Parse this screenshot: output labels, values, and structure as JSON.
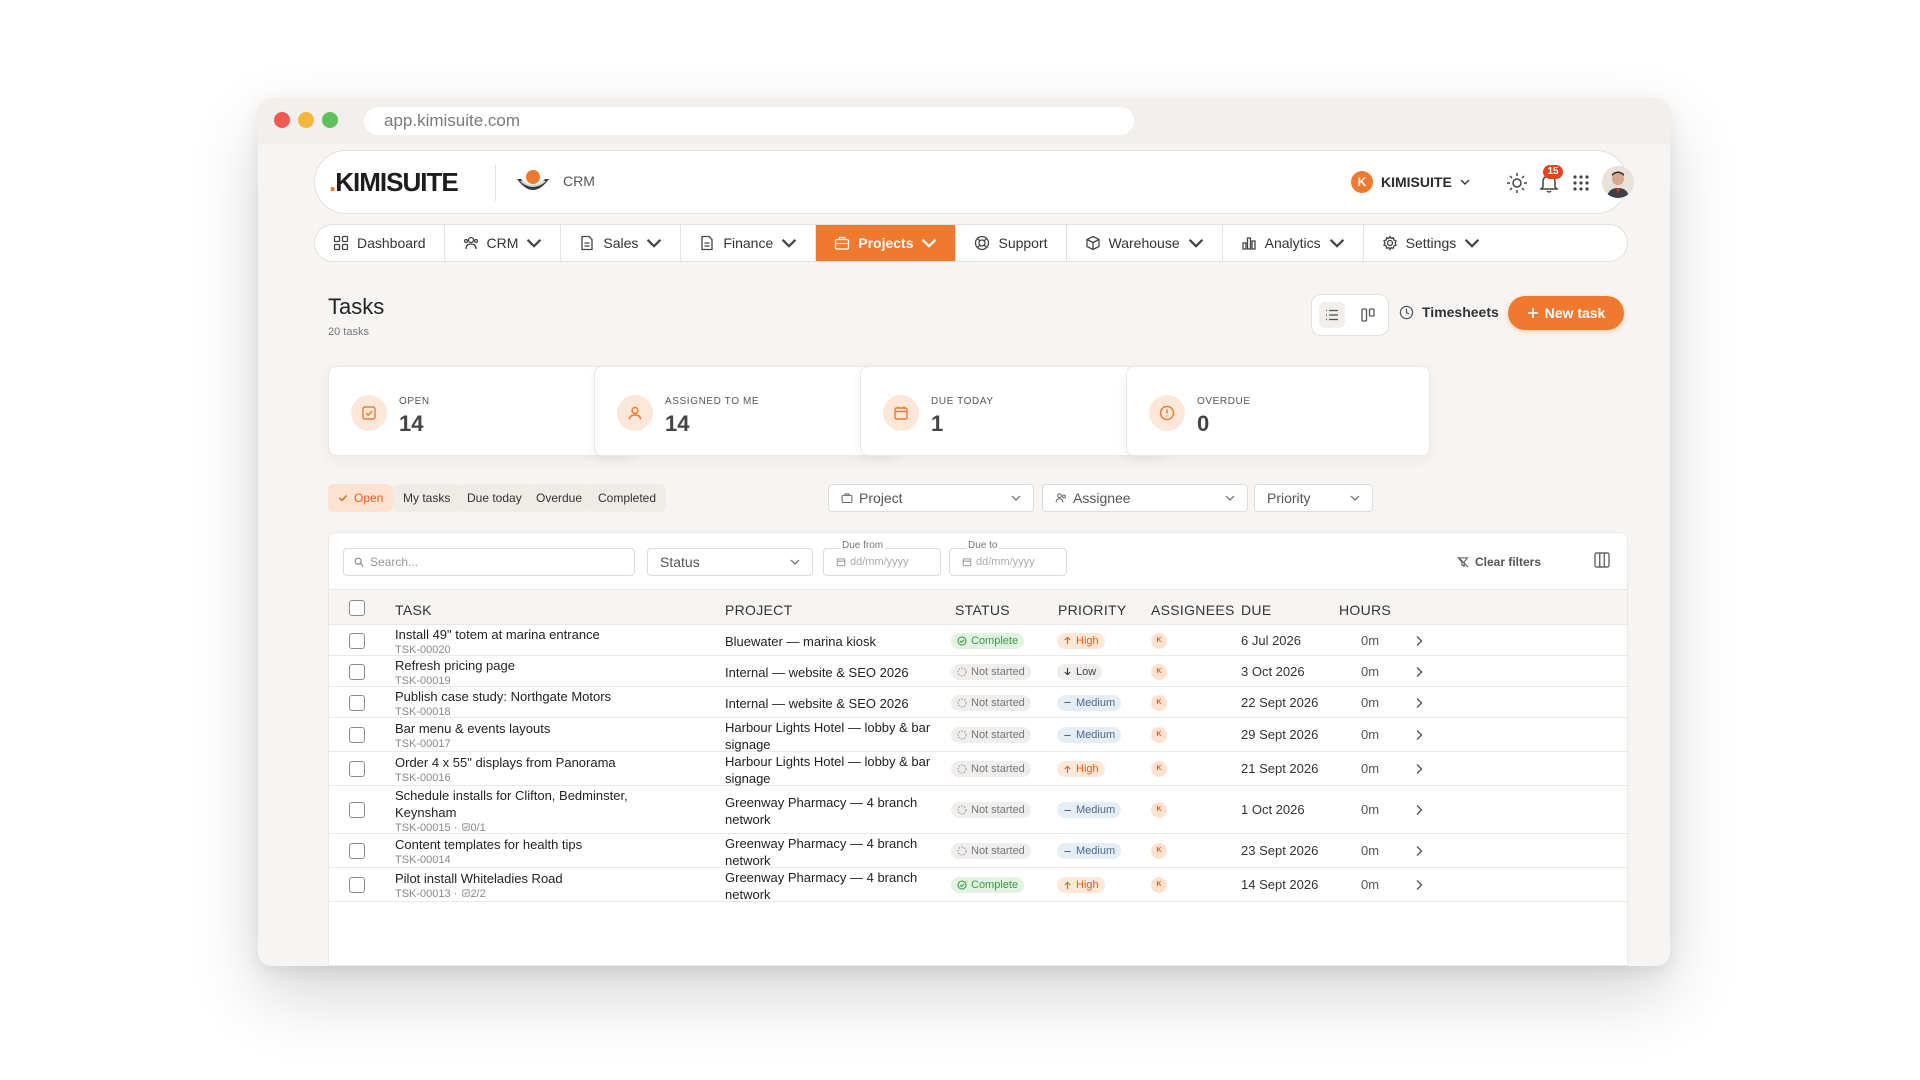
{
  "browser": {
    "url": "app.kimisuite.com"
  },
  "header": {
    "logo_dot": ".",
    "logo_text": "KIMISUITE",
    "module_label": "CRM",
    "org_initial": "K",
    "org_name": "KIMISUITE",
    "notifications_count": "15"
  },
  "nav": {
    "items": [
      {
        "label": "Dashboard",
        "icon": "grid-icon"
      },
      {
        "label": "CRM",
        "icon": "users-icon"
      },
      {
        "label": "Sales",
        "icon": "document-icon"
      },
      {
        "label": "Finance",
        "icon": "document-icon"
      },
      {
        "label": "Projects",
        "icon": "briefcase-icon",
        "active": true
      },
      {
        "label": "Support",
        "icon": "lifebuoy-icon"
      },
      {
        "label": "Warehouse",
        "icon": "box-icon"
      },
      {
        "label": "Analytics",
        "icon": "bar-chart-icon"
      },
      {
        "label": "Settings",
        "icon": "gear-icon"
      }
    ]
  },
  "page": {
    "title": "Tasks",
    "subtitle": "20 tasks",
    "timesheets_label": "Timesheets",
    "new_task_label": "New task"
  },
  "stats": [
    {
      "label": "OPEN",
      "value": "14",
      "icon": "check-square-icon"
    },
    {
      "label": "ASSIGNED TO ME",
      "value": "14",
      "icon": "user-icon"
    },
    {
      "label": "DUE TODAY",
      "value": "1",
      "icon": "calendar-icon"
    },
    {
      "label": "OVERDUE",
      "value": "0",
      "icon": "alert-circle-icon"
    }
  ],
  "quick_filters": [
    {
      "label": "Open",
      "active": true
    },
    {
      "label": "My tasks"
    },
    {
      "label": "Due today"
    },
    {
      "label": "Overdue"
    },
    {
      "label": "Completed"
    }
  ],
  "filters": {
    "project": "Project",
    "assignee": "Assignee",
    "priority": "Priority"
  },
  "table_tools": {
    "search_placeholder": "Search...",
    "status": "Status",
    "due_from_label": "Due from",
    "due_to_label": "Due to",
    "date_placeholder": "dd/mm/yyyy",
    "clear_filters": "Clear filters"
  },
  "columns": [
    "TASK",
    "PROJECT",
    "STATUS",
    "PRIORITY",
    "ASSIGNEES",
    "DUE",
    "HOURS"
  ],
  "rows": [
    {
      "task": "Install 49\" totem at marina entrance",
      "id": "TSK-00020",
      "subtasks": "",
      "project": "Bluewater — marina kiosk",
      "status": "Complete",
      "priority": "High",
      "assignee": "K",
      "due": "6 Jul 2026",
      "hours": "0m"
    },
    {
      "task": "Refresh pricing page",
      "id": "TSK-00019",
      "subtasks": "",
      "project": "Internal — website & SEO 2026",
      "status": "Not started",
      "priority": "Low",
      "assignee": "K",
      "due": "3 Oct 2026",
      "hours": "0m"
    },
    {
      "task": "Publish case study: Northgate Motors",
      "id": "TSK-00018",
      "subtasks": "",
      "project": "Internal — website & SEO 2026",
      "status": "Not started",
      "priority": "Medium",
      "assignee": "K",
      "due": "22 Sept 2026",
      "hours": "0m"
    },
    {
      "task": "Bar menu & events layouts",
      "id": "TSK-00017",
      "subtasks": "",
      "project": "Harbour Lights Hotel — lobby & bar signage",
      "status": "Not started",
      "priority": "Medium",
      "assignee": "K",
      "due": "29 Sept 2026",
      "hours": "0m"
    },
    {
      "task": "Order 4 x 55\" displays from Panorama",
      "id": "TSK-00016",
      "subtasks": "",
      "project": "Harbour Lights Hotel — lobby & bar signage",
      "status": "Not started",
      "priority": "High",
      "assignee": "K",
      "due": "21 Sept 2026",
      "hours": "0m"
    },
    {
      "task": "Schedule installs for Clifton, Bedminster, Keynsham",
      "id": "TSK-00015 ·",
      "subtasks": "0/1",
      "project": "Greenway Pharmacy — 4 branch network",
      "status": "Not started",
      "priority": "Medium",
      "assignee": "K",
      "due": "1 Oct 2026",
      "hours": "0m"
    },
    {
      "task": "Content templates for health tips",
      "id": "TSK-00014",
      "subtasks": "",
      "project": "Greenway Pharmacy — 4 branch network",
      "status": "Not started",
      "priority": "Medium",
      "assignee": "K",
      "due": "23 Sept 2026",
      "hours": "0m"
    },
    {
      "task": "Pilot install Whiteladies Road",
      "id": "TSK-00013 ·",
      "subtasks": "2/2",
      "project": "Greenway Pharmacy — 4 branch network",
      "status": "Complete",
      "priority": "High",
      "assignee": "K",
      "due": "14 Sept 2026",
      "hours": "0m"
    }
  ],
  "colors": {
    "accent": "#ef7a2f",
    "complete": "#3a9a44",
    "badge_red": "#e2461f"
  }
}
